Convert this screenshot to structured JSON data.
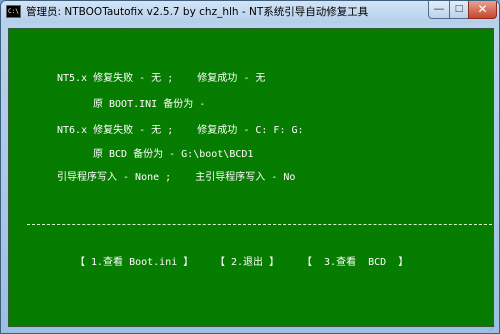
{
  "window": {
    "title": "管理员:  NTBOOTautofix v2.5.7 by chz_hlh - NT系统引导自动修复工具",
    "icon_text": "C:\\",
    "buttons": {
      "minimize": "—",
      "maximize": "□",
      "close": "✕"
    }
  },
  "console": {
    "nt5_status": "NT5.x 修复失败 - 无 ;    修复成功 - 无",
    "nt5_backup": "原 BOOT.INI 备份为 -",
    "nt6_status": "NT6.x 修复失败 - 无 ;    修复成功 - C: F: G:",
    "nt6_backup": "原 BCD 备份为 - G:\\boot\\BCD1",
    "write_status": "引导程序写入 - None ;    主引导程序写入 - No",
    "menu": {
      "view_bootini": "【 1.查看 Boot.ini 】",
      "exit": "【 2.退出 】",
      "view_bcd": "【  3.查看  BCD  】"
    }
  },
  "colors": {
    "console_bg": "#067d00",
    "console_text": "#ffffff",
    "close_button": "#c5462c"
  }
}
